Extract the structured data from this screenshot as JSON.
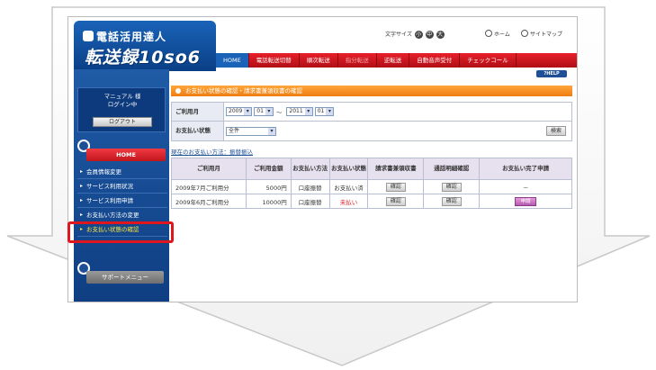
{
  "header": {
    "logo_line1": "電話活用達人",
    "logo_line2": "転送録10so6",
    "font_size_label": "文字サイズ",
    "font_size_buttons": [
      "小",
      "中",
      "大"
    ],
    "home_link": "ホーム",
    "sitemap_link": "サイトマップ",
    "help_label": "?HELP"
  },
  "nav": {
    "items": [
      {
        "label": "HOME",
        "dim": false
      },
      {
        "label": "電話転送切替",
        "dim": false
      },
      {
        "label": "順次転送",
        "dim": false
      },
      {
        "label": "指分転送",
        "dim": true
      },
      {
        "label": "逆転送",
        "dim": false
      },
      {
        "label": "自動音声受付",
        "dim": false
      },
      {
        "label": "チェックコール",
        "dim": false
      }
    ]
  },
  "sidebar": {
    "user_line1": "マニュアル 様",
    "user_line2": "ログイン中",
    "logout_label": "ログアウト",
    "home_label": "HOME",
    "menu": [
      "会員情報変更",
      "サービス利用状況",
      "サービス利用申請",
      "お支払い方法の変更",
      "お支払い状態の確認"
    ],
    "active_index": 4,
    "support_label": "サポートメニュー"
  },
  "main": {
    "title": "お支払い状態の確認・請求書兼領収書の確認",
    "search": {
      "period_label": "ご利用月",
      "from_year": "2009",
      "from_month": "01",
      "tilde": "～",
      "to_year": "2011",
      "to_month": "01",
      "status_label": "お支払い状態",
      "status_value": "全件",
      "search_button": "検索"
    },
    "method_text": "現在のお支払い方法：振替振込",
    "table": {
      "headers": [
        "ご利用月",
        "ご利用金額",
        "お支払い方法",
        "お支払い状態",
        "請求書兼領収書",
        "通話明細確認",
        "お支払い完了申請"
      ],
      "rows": [
        {
          "month": "2009年7月ご利用分",
          "amount": "5000円",
          "method": "口座振替",
          "status": "お支払い済",
          "invoice": "確認",
          "detail": "確認",
          "apply": "－",
          "unpaid": false
        },
        {
          "month": "2009年6月ご利用分",
          "amount": "10000円",
          "method": "口座振替",
          "status": "未払い",
          "invoice": "確認",
          "detail": "確認",
          "apply": "申請",
          "unpaid": true
        }
      ]
    }
  },
  "colors": {
    "brand_blue": "#1a63b8",
    "nav_red": "#e8202a",
    "title_orange": "#ee7d12",
    "highlight_red": "#e0161f"
  }
}
